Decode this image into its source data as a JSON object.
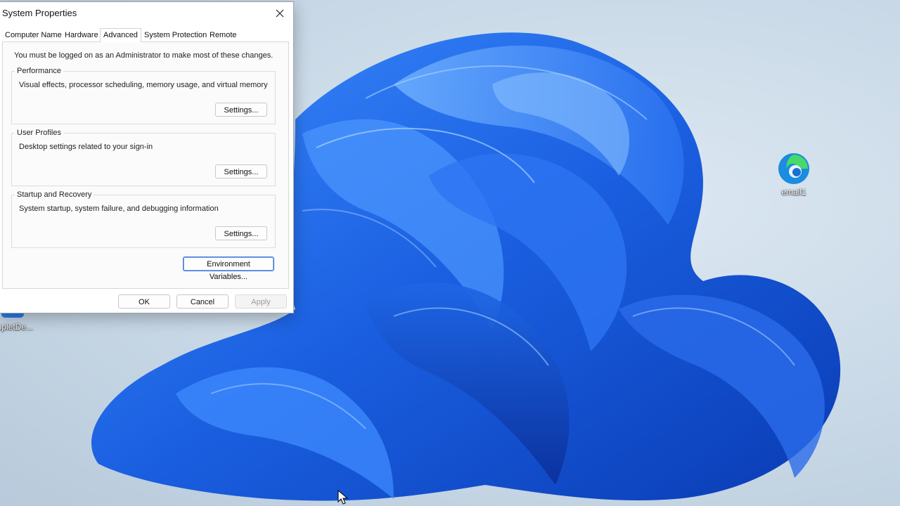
{
  "dialog": {
    "title": "System Properties",
    "tabs": [
      {
        "label": "Computer Name"
      },
      {
        "label": "Hardware"
      },
      {
        "label": "Advanced",
        "active": true
      },
      {
        "label": "System Protection"
      },
      {
        "label": "Remote"
      }
    ],
    "admin_note": "You must be logged on as an Administrator to make most of these changes.",
    "performance": {
      "label": "Performance",
      "description": "Visual effects, processor scheduling, memory usage, and virtual memory",
      "button": "Settings..."
    },
    "user_profiles": {
      "label": "User Profiles",
      "description": "Desktop settings related to your sign-in",
      "button": "Settings..."
    },
    "startup_recovery": {
      "label": "Startup and Recovery",
      "description": "System startup, system failure, and debugging information",
      "button": "Settings..."
    },
    "env_button": "Environment Variables...",
    "ok": "OK",
    "cancel": "Cancel",
    "apply": "Apply"
  },
  "desktop": {
    "icons": [
      {
        "label": "email1",
        "icon": "edge-icon"
      },
      {
        "label": "appletDe...",
        "icon": "app-icon"
      }
    ],
    "accent": "#1a5fe0"
  }
}
